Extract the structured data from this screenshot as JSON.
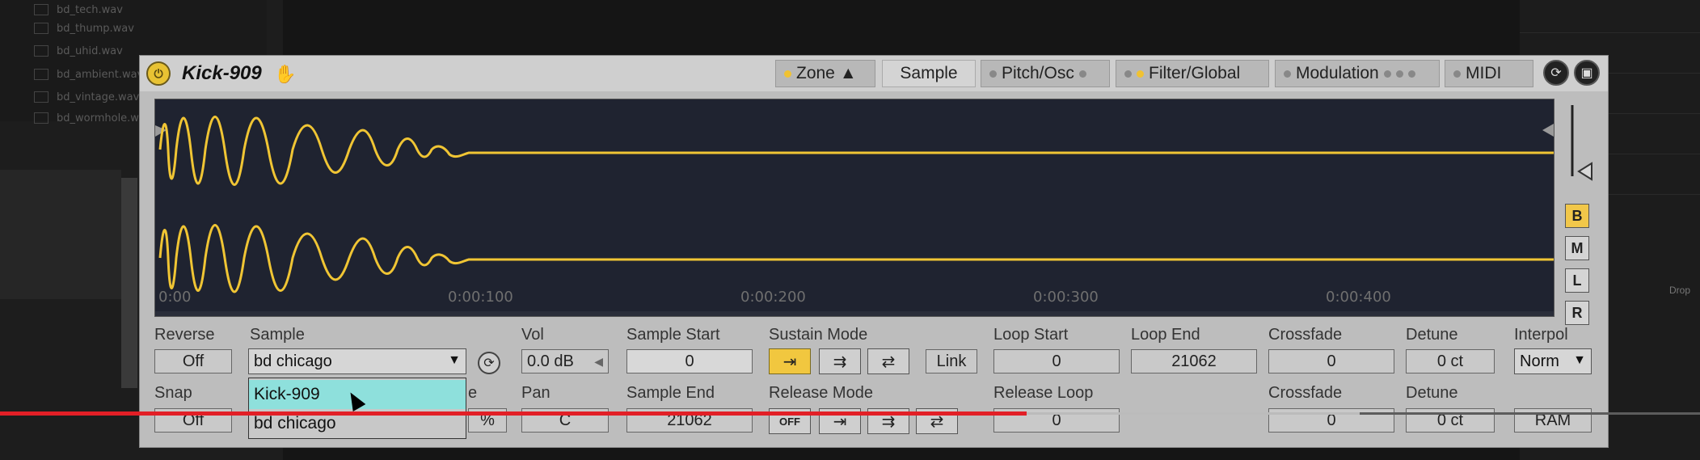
{
  "background": {
    "browser_files": [
      "bd_tech.wav",
      "bd_thump.wav",
      "bd_uhid.wav",
      "bd_ambient.wav",
      "bd_vintage.wav",
      "bd_wormhole.wav"
    ],
    "right_edge_text": "Drop"
  },
  "device": {
    "title": "Kick-909",
    "tabs": [
      "Zone",
      "Sample",
      "Pitch/Osc",
      "Filter/Global",
      "Modulation",
      "MIDI"
    ],
    "active_tab": "Sample"
  },
  "waveform": {
    "time_labels": [
      "0:00",
      "0:00:100",
      "0:00:200",
      "0:00:300",
      "0:00:400"
    ],
    "side_buttons": [
      "B",
      "M",
      "L",
      "R"
    ],
    "active_side_button": "B"
  },
  "controls": {
    "reverse": {
      "label": "Reverse",
      "value": "Off"
    },
    "sample": {
      "label": "Sample",
      "value": "bd chicago"
    },
    "vol": {
      "label": "Vol",
      "value": "0.0 dB"
    },
    "sample_start": {
      "label": "Sample Start",
      "value": "0"
    },
    "sustain_mode": {
      "label": "Sustain Mode",
      "link": "Link"
    },
    "loop_start": {
      "label": "Loop Start",
      "value": "0"
    },
    "loop_end": {
      "label": "Loop End",
      "value": "21062"
    },
    "crossfade": {
      "label": "Crossfade",
      "value": "0"
    },
    "detune": {
      "label": "Detune",
      "value": "0 ct"
    },
    "interpol": {
      "label": "Interpol",
      "value": "Norm"
    },
    "snap": {
      "label": "Snap",
      "value": "Off"
    },
    "pan": {
      "label": "Pan",
      "value": "C"
    },
    "sample_end": {
      "label": "Sample End",
      "value": "21062"
    },
    "release_mode": {
      "label": "Release Mode",
      "off": "OFF"
    },
    "release_loop": {
      "label": "Release Loop",
      "value": "0"
    },
    "crossfade2": {
      "label": "Crossfade",
      "value": "0"
    },
    "detune2": {
      "label": "Detune",
      "value": "0 ct"
    },
    "ram": "RAM",
    "hidden_suffix": "e",
    "hidden_pct": "%"
  },
  "sample_dropdown": {
    "options": [
      "Kick-909",
      "bd chicago"
    ],
    "highlighted": "Kick-909"
  },
  "video_progress": {
    "played_fraction": 0.604,
    "buffered_fraction": 0.8
  }
}
